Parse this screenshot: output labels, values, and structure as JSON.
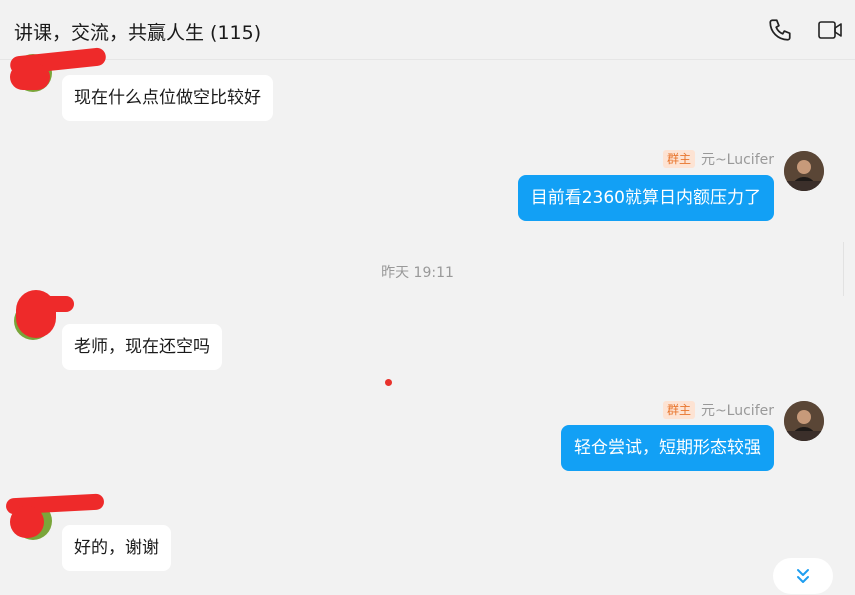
{
  "header": {
    "title": "讲课，交流，共赢人生 (115)",
    "phone_icon": "phone-icon",
    "video_icon": "video-camera-icon"
  },
  "messages": [
    {
      "side": "left",
      "text": "现在什么点位做空比较好"
    },
    {
      "side": "right",
      "role": "群主",
      "sender": "元~Lucifer",
      "text": "目前看2360就算日内额压力了"
    },
    {
      "side": "left",
      "text": "老师，现在还空吗"
    },
    {
      "side": "right",
      "role": "群主",
      "sender": "元~Lucifer",
      "text": "轻仓尝试，短期形态较强"
    },
    {
      "side": "left",
      "text": "好的，谢谢"
    }
  ],
  "timestamp": "昨天 19:11",
  "scroll_button_icon": "double-chevron-down-icon",
  "colors": {
    "background": "#f2f2f2",
    "bubble_self": "#12a0f5",
    "bubble_other": "#ffffff",
    "role_badge_bg": "#fde3d3",
    "role_badge_text": "#e8762e",
    "redaction": "#ee2a2a"
  }
}
